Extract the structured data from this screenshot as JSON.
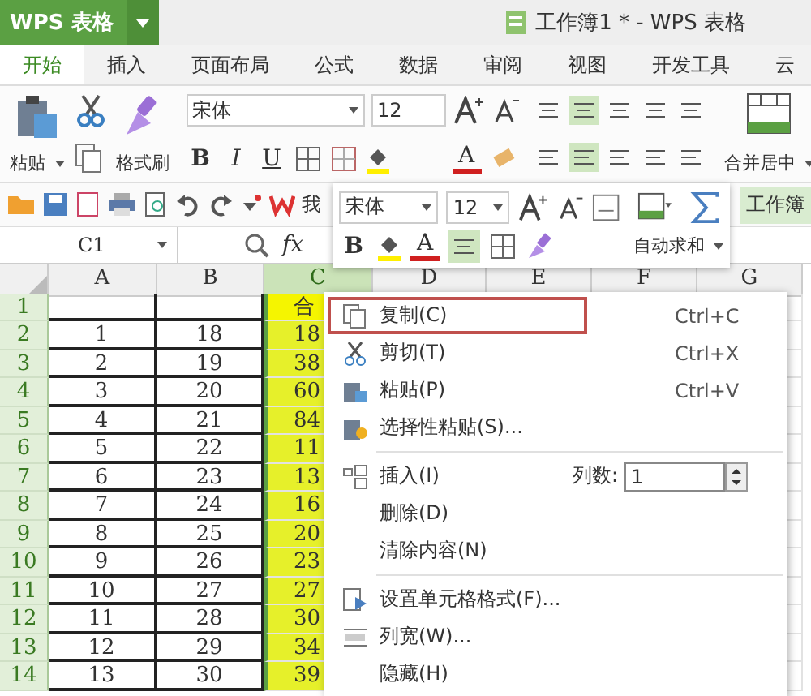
{
  "title_bar": {
    "app_button": "WPS 表格",
    "document_title": "工作簿1 * - WPS 表格"
  },
  "tabs": [
    {
      "label": "开始",
      "selected": true
    },
    {
      "label": "插入",
      "selected": false
    },
    {
      "label": "页面布局",
      "selected": false
    },
    {
      "label": "公式",
      "selected": false
    },
    {
      "label": "数据",
      "selected": false
    },
    {
      "label": "审阅",
      "selected": false
    },
    {
      "label": "视图",
      "selected": false
    },
    {
      "label": "开发工具",
      "selected": false
    },
    {
      "label": "云",
      "selected": false
    }
  ],
  "ribbon": {
    "paste": "粘贴",
    "format_painter": "格式刷",
    "font_name": "宋体",
    "font_size": "12",
    "bold": "B",
    "italic": "I",
    "underline": "U",
    "font_color": "A",
    "merge": "合并居中"
  },
  "quick_toolbar": {
    "text": "我",
    "document_tab": "工作簿"
  },
  "formula_bar": {
    "name_box": "C1",
    "fx": "fx"
  },
  "mini_toolbar": {
    "font_name": "宋体",
    "font_size": "12",
    "bold": "B",
    "font_color": "A",
    "autosum": "自动求和"
  },
  "sheet": {
    "columns": [
      {
        "label": "A",
        "selected": false
      },
      {
        "label": "B",
        "selected": false
      },
      {
        "label": "C",
        "selected": true
      },
      {
        "label": "D",
        "selected": false
      },
      {
        "label": "E",
        "selected": false
      },
      {
        "label": "F",
        "selected": false
      },
      {
        "label": "G",
        "selected": false
      }
    ],
    "rows": [
      {
        "header": "1",
        "cells": [
          "",
          "",
          "合"
        ]
      },
      {
        "header": "2",
        "cells": [
          "1",
          "18",
          "18"
        ]
      },
      {
        "header": "3",
        "cells": [
          "2",
          "19",
          "38"
        ]
      },
      {
        "header": "4",
        "cells": [
          "3",
          "20",
          "60"
        ]
      },
      {
        "header": "5",
        "cells": [
          "4",
          "21",
          "84"
        ]
      },
      {
        "header": "6",
        "cells": [
          "5",
          "22",
          "11"
        ]
      },
      {
        "header": "7",
        "cells": [
          "6",
          "23",
          "13"
        ]
      },
      {
        "header": "8",
        "cells": [
          "7",
          "24",
          "16"
        ]
      },
      {
        "header": "9",
        "cells": [
          "8",
          "25",
          "20"
        ]
      },
      {
        "header": "10",
        "cells": [
          "9",
          "26",
          "23"
        ]
      },
      {
        "header": "11",
        "cells": [
          "10",
          "27",
          "27"
        ]
      },
      {
        "header": "12",
        "cells": [
          "11",
          "28",
          "30"
        ]
      },
      {
        "header": "13",
        "cells": [
          "12",
          "29",
          "34"
        ]
      },
      {
        "header": "14",
        "cells": [
          "13",
          "30",
          "39"
        ]
      }
    ]
  },
  "context_menu": {
    "groups": [
      [
        {
          "kind": "command",
          "label": "复制(C)",
          "shortcut": "Ctrl+C",
          "selected": true
        },
        {
          "kind": "command",
          "label": "剪切(T)",
          "shortcut": "Ctrl+X",
          "selected": false
        },
        {
          "kind": "command",
          "label": "粘贴(P)",
          "shortcut": "Ctrl+V",
          "selected": false
        },
        {
          "kind": "command",
          "label": "选择性粘贴(S)...",
          "selected": false
        }
      ],
      [
        {
          "kind": "insert",
          "label": "插入(I)",
          "count_label": "列数:",
          "count_value": "1",
          "selected": false
        },
        {
          "kind": "command",
          "label": "删除(D)",
          "selected": false
        },
        {
          "kind": "command",
          "label": "清除内容(N)",
          "selected": false
        }
      ],
      [
        {
          "kind": "command",
          "label": "设置单元格格式(F)...",
          "selected": false
        },
        {
          "kind": "command",
          "label": "列宽(W)...",
          "selected": false
        },
        {
          "kind": "command",
          "label": "隐藏(H)",
          "selected": false
        }
      ]
    ]
  }
}
